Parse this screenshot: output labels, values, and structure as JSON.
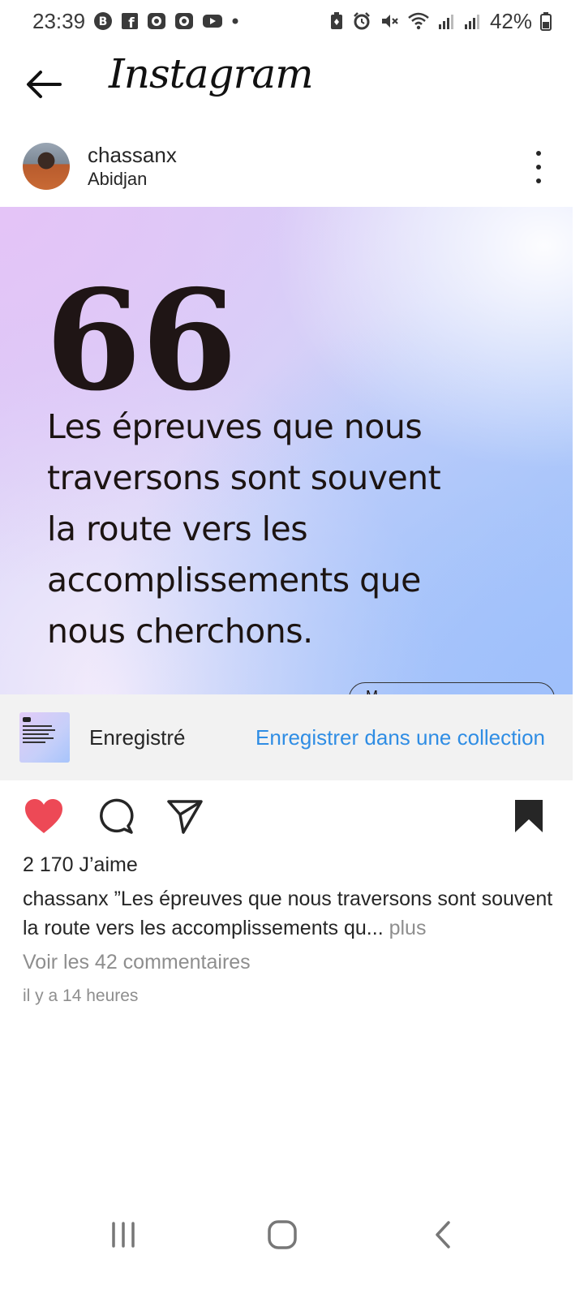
{
  "status_bar": {
    "time": "23:39",
    "battery": "42%",
    "left_icons": [
      "b-badge-icon",
      "facebook-icon",
      "messenger-icon",
      "messenger-icon",
      "youtube-icon",
      "dot-icon"
    ],
    "right_icons": [
      "battery-saver-icon",
      "alarm-icon",
      "mute-icon",
      "wifi-icon",
      "signal-icon",
      "signal-icon"
    ]
  },
  "header": {
    "brand": "Instagram",
    "back_icon": "arrow-left-icon"
  },
  "post": {
    "username": "chassanx",
    "location": "Abidjan",
    "more_icon": "more-vertical-icon",
    "image": {
      "quote_mark": "66",
      "quote_lines": [
        "Les épreuves que nous",
        "traversons sont souvent",
        "la route vers les",
        "accomplissements que",
        "nous cherchons."
      ],
      "author_partial": "M... "
    },
    "saved": {
      "label": "Enregistré",
      "link": "Enregistrer dans une collection"
    },
    "actions": {
      "like_icon": "heart-filled-icon",
      "comment_icon": "comment-icon",
      "share_icon": "send-icon",
      "save_icon": "bookmark-filled-icon",
      "like_color": "#ed4956"
    },
    "likes": "2 170 J’aime",
    "caption": {
      "user": "chassanx",
      "text": " ”Les épreuves que nous traversons sont souvent la route vers les accomplissements qu",
      "ellipsis": "...",
      "more": " plus"
    },
    "comments_link": "Voir les 42 commentaires",
    "time_ago": "il y a 14 heures"
  },
  "nav_bar": {
    "recents_icon": "recents-icon",
    "home_icon": "home-icon",
    "back_icon": "back-chevron-icon"
  }
}
